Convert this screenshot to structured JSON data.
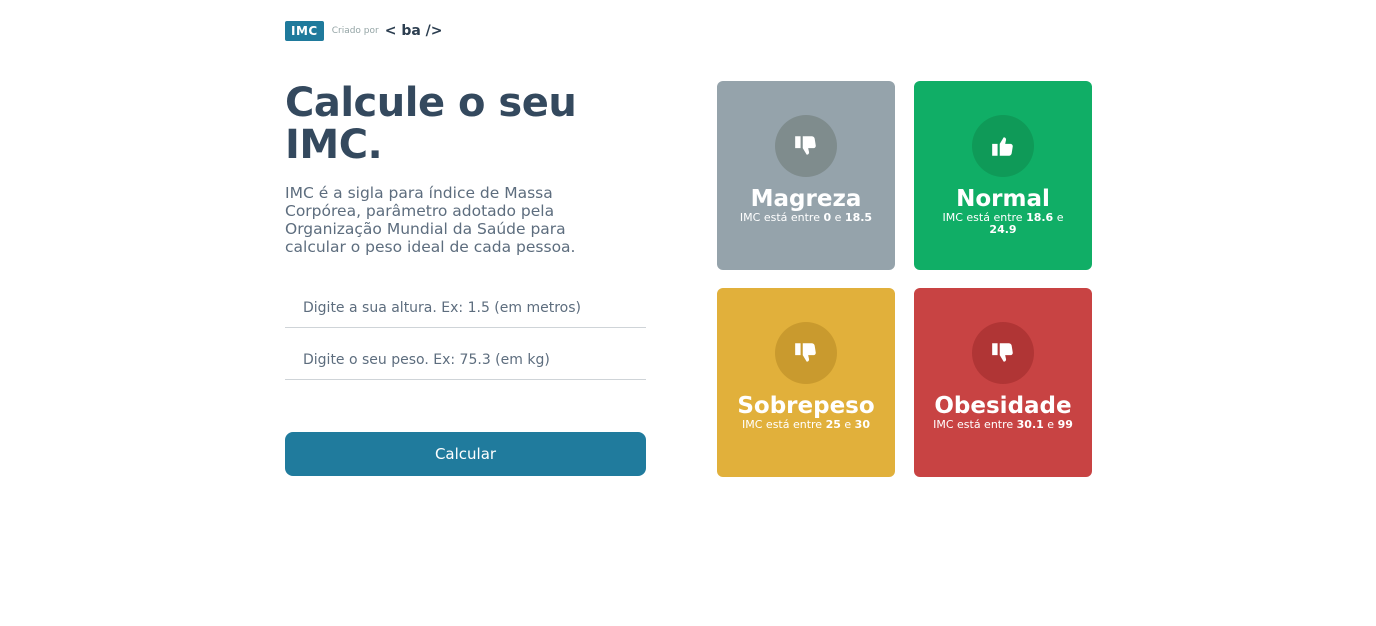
{
  "header": {
    "logo": "IMC",
    "created_by": "Criado por",
    "brand": "ba",
    "brand_open": "<",
    "brand_close": "/>"
  },
  "hero": {
    "title_line1": "Calcule o seu",
    "title_line2": "IMC.",
    "description": "IMC é a sigla para índice de Massa Corpórea, parâmetro adotado pela Organização Mundial da Saúde para calcular o peso ideal de cada pessoa."
  },
  "form": {
    "height_placeholder": "Digite a sua altura. Ex: 1.5 (em metros)",
    "weight_placeholder": "Digite o seu peso. Ex: 75.3 (em kg)",
    "submit_label": "Calcular"
  },
  "cards": [
    {
      "title": "Magreza",
      "prefix": "IMC está entre",
      "min": "0",
      "mid": "e",
      "max": "18.5",
      "icon": "thumbs-down-icon",
      "color": "#95a3ab"
    },
    {
      "title": "Normal",
      "prefix": "IMC está entre",
      "min": "18.6",
      "mid": "e",
      "max": "24.9",
      "icon": "thumbs-up-icon",
      "color": "#10ae66"
    },
    {
      "title": "Sobrepeso",
      "prefix": "IMC está entre",
      "min": "25",
      "mid": "e",
      "max": "30",
      "icon": "thumbs-down-icon",
      "color": "#e1b03b"
    },
    {
      "title": "Obesidade",
      "prefix": "IMC está entre",
      "min": "30.1",
      "mid": "e",
      "max": "99",
      "icon": "thumbs-down-icon",
      "color": "#c84343"
    }
  ]
}
